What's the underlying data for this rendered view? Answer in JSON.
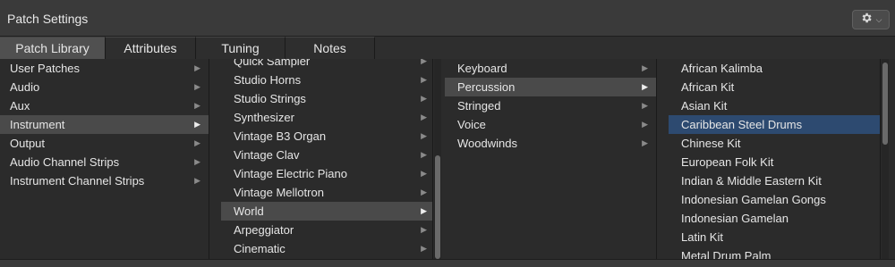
{
  "window": {
    "title": "Patch Settings"
  },
  "toolbar": {
    "gear_menu_icon": "gear-icon"
  },
  "tabs": [
    {
      "label": "Patch Library",
      "active": true
    },
    {
      "label": "Attributes",
      "active": false
    },
    {
      "label": "Tuning",
      "active": false
    },
    {
      "label": "Notes",
      "active": false
    }
  ],
  "columns": {
    "col1": {
      "items": [
        {
          "label": "User Patches"
        },
        {
          "label": "Audio"
        },
        {
          "label": "Aux"
        },
        {
          "label": "Instrument",
          "selected": true
        },
        {
          "label": "Output"
        },
        {
          "label": "Audio Channel Strips"
        },
        {
          "label": "Instrument Channel Strips"
        }
      ]
    },
    "col2": {
      "items": [
        {
          "label": "Quick Sampler"
        },
        {
          "label": "Studio Horns"
        },
        {
          "label": "Studio Strings"
        },
        {
          "label": "Synthesizer"
        },
        {
          "label": "Vintage B3 Organ"
        },
        {
          "label": "Vintage Clav"
        },
        {
          "label": "Vintage Electric Piano"
        },
        {
          "label": "Vintage Mellotron"
        },
        {
          "label": "World",
          "selected": true
        },
        {
          "label": "Arpeggiator"
        },
        {
          "label": "Cinematic"
        }
      ]
    },
    "col3": {
      "items": [
        {
          "label": "Keyboard"
        },
        {
          "label": "Percussion",
          "selected": true
        },
        {
          "label": "Stringed"
        },
        {
          "label": "Voice"
        },
        {
          "label": "Woodwinds"
        }
      ]
    },
    "col4": {
      "items": [
        {
          "label": "African Kalimba"
        },
        {
          "label": "African Kit"
        },
        {
          "label": "Asian Kit"
        },
        {
          "label": "Caribbean Steel Drums",
          "selected": true
        },
        {
          "label": "Chinese Kit"
        },
        {
          "label": "European Folk Kit"
        },
        {
          "label": "Indian & Middle Eastern Kit"
        },
        {
          "label": "Indonesian Gamelan Gongs"
        },
        {
          "label": "Indonesian Gamelan"
        },
        {
          "label": "Latin Kit"
        },
        {
          "label": "Metal Drum Palm"
        }
      ]
    }
  },
  "colors": {
    "selection_gray": "#4a4a4a",
    "selection_blue": "#2d4a70"
  }
}
